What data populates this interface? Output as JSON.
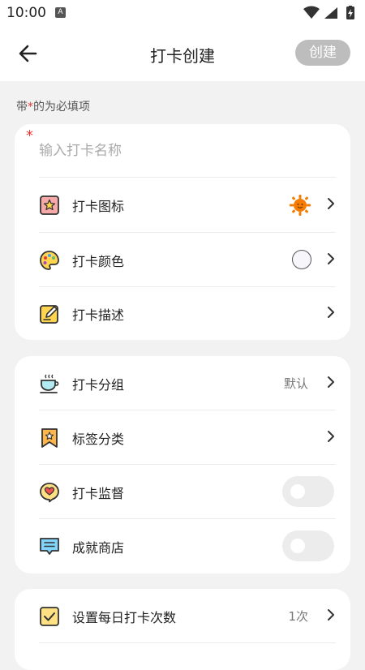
{
  "status_bar": {
    "time": "10:00"
  },
  "header": {
    "title": "打卡创建",
    "create_label": "创建"
  },
  "hint": {
    "prefix": "带",
    "star": "*",
    "suffix": "的为必填项"
  },
  "form": {
    "name_placeholder": "输入打卡名称",
    "required_mark": "*",
    "rows": [
      {
        "label": "打卡图标",
        "icon": "star-frame-icon"
      },
      {
        "label": "打卡颜色",
        "icon": "palette-icon"
      },
      {
        "label": "打卡描述",
        "icon": "pencil-note-icon"
      }
    ]
  },
  "settings": {
    "rows": [
      {
        "label": "打卡分组",
        "value": "默认",
        "icon": "cup-icon"
      },
      {
        "label": "标签分类",
        "icon": "bookmark-icon"
      },
      {
        "label": "打卡监督",
        "icon": "heart-bubble-icon",
        "enabled": false
      },
      {
        "label": "成就商店",
        "icon": "chat-card-icon",
        "enabled": false
      }
    ]
  },
  "daily": {
    "label": "设置每日打卡次数",
    "value": "1次",
    "icon": "checkbox-icon"
  },
  "colors": {
    "accent_red": "#e53935",
    "button_disabled": "#bdbdbd"
  }
}
